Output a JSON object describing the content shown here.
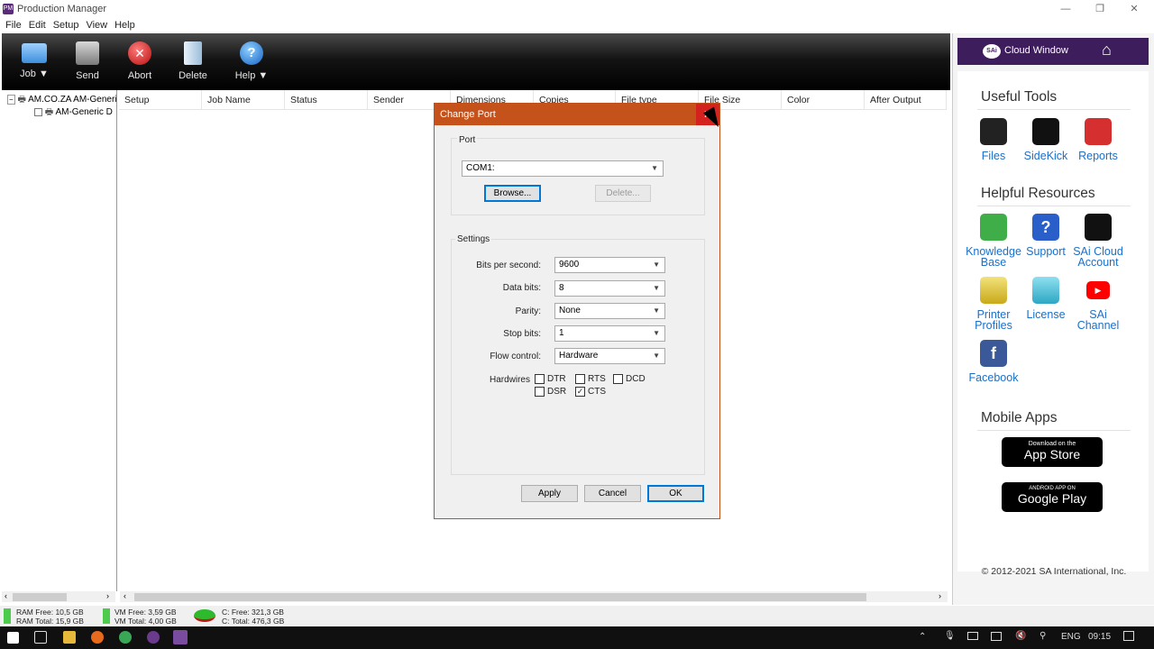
{
  "window": {
    "title": "Production Manager",
    "app_icon": "PM",
    "min": "—",
    "max": "❐",
    "close": "✕"
  },
  "menu": [
    "File",
    "Edit",
    "Setup",
    "View",
    "Help"
  ],
  "toolbar": {
    "job": "Job ▼",
    "send": "Send",
    "abort": "Abort",
    "delete": "Delete",
    "help": "Help ▼"
  },
  "tree": {
    "root": "AM.CO.ZA AM-Generic D",
    "child": "AM-Generic D"
  },
  "columns": [
    "Setup",
    "Job Name",
    "Status",
    "Sender",
    "Dimensions",
    "Copies",
    "File type",
    "File Size",
    "Color",
    "After Output"
  ],
  "status": {
    "ram_free": "RAM Free: 10,5 GB",
    "ram_total": "RAM Total: 15,9 GB",
    "vm_free": "VM Free: 3,59 GB",
    "vm_total": "VM Total: 4,00 GB",
    "c_free": "C: Free: 321,3 GB",
    "c_total": "C: Total: 476,3 GB"
  },
  "dialog": {
    "title": "Change Port",
    "close": "✕",
    "port_group": "Port",
    "port_value": "COM1:",
    "browse": "Browse...",
    "delete": "Delete...",
    "settings_group": "Settings",
    "bits_label": "Bits per second:",
    "bits_value": "9600",
    "data_label": "Data bits:",
    "data_value": "8",
    "parity_label": "Parity:",
    "parity_value": "None",
    "stop_label": "Stop bits:",
    "stop_value": "1",
    "flow_label": "Flow control:",
    "flow_value": "Hardware",
    "hardwires_label": "Hardwires",
    "dtr": "DTR",
    "rts": "RTS",
    "dcd": "DCD",
    "dsr": "DSR",
    "cts": "CTS",
    "dtr_checked": false,
    "rts_checked": false,
    "dcd_checked": false,
    "dsr_checked": false,
    "cts_checked": true,
    "apply": "Apply",
    "cancel": "Cancel",
    "ok": "OK"
  },
  "right_panel": {
    "cloud_label": "Cloud Window",
    "cloud_logo": "SAi",
    "useful_tools": "Useful Tools",
    "files": "Files",
    "sidekick": "SideKick",
    "reports": "Reports",
    "helpful_resources": "Helpful Resources",
    "kb1": "Knowledge",
    "kb2": "Base",
    "support": "Support",
    "cloud1": "SAi Cloud",
    "cloud2": "Account",
    "pp1": "Printer",
    "pp2": "Profiles",
    "license": "License",
    "ch1": "SAi",
    "ch2": "Channel",
    "facebook": "Facebook",
    "mobile_apps": "Mobile Apps",
    "appstore_small": "Download on the",
    "appstore_big": "App Store",
    "gplay_small": "ANDROID APP ON",
    "gplay_big": "Google Play",
    "copyright": "© 2012-2021 SA International, Inc."
  },
  "taskbar": {
    "lang": "ENG",
    "time": "09:15"
  },
  "colors": {
    "dialog_title": "#c5521b",
    "cloud_bar": "#3e1d5c",
    "link": "#1c6fc7"
  }
}
